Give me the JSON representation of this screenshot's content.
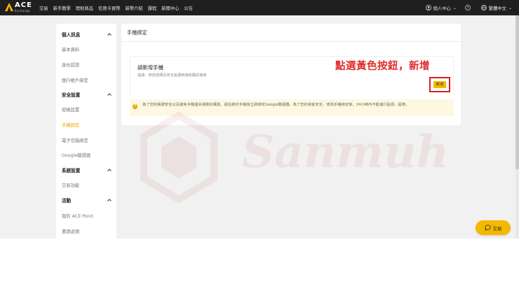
{
  "nav": {
    "logo_title": "ACE",
    "logo_sub": "Exchange",
    "links": [
      "交易",
      "新手教學",
      "理財商品",
      "信用卡買幣",
      "新幣介紹",
      "課程",
      "新聞中心",
      "公告"
    ],
    "account_label": "個人中心",
    "language_label": "繁體中文"
  },
  "sidebar": {
    "sections": [
      {
        "title": "個人訊息",
        "items": [
          "基本資料",
          "身份認證",
          "銀行帳戶綁定"
        ]
      },
      {
        "title": "安全設置",
        "items": [
          "密碼設置",
          "手機綁定",
          "電子信箱綁定",
          "Google驗證器"
        ]
      },
      {
        "title": "系統設置",
        "items": [
          "交易功能"
        ]
      },
      {
        "title": "活動",
        "items": [
          "我的 ACE Point",
          "邀請返佣"
        ]
      }
    ],
    "active_item": "手機綁定"
  },
  "main": {
    "title": "手機綁定",
    "add_title": "請新增手機",
    "add_desc": "提綠，修改密碼及安全設置時接收驗訊使用",
    "annotation": "點選黃色按鈕，新增",
    "add_button": "新增",
    "notice": "為了您的帳號安全以及避免手機遺失導致的風險，請在綁定手機後立即綁定Google驗證器，為了您的資金安全，修改手機綁定後，24小時內不能進行提領，提幣。"
  },
  "trade_button": "交易",
  "colors": {
    "accent": "#f5b800",
    "annotation_red": "#e12d2d",
    "nav_bg": "#1f1f1f"
  }
}
